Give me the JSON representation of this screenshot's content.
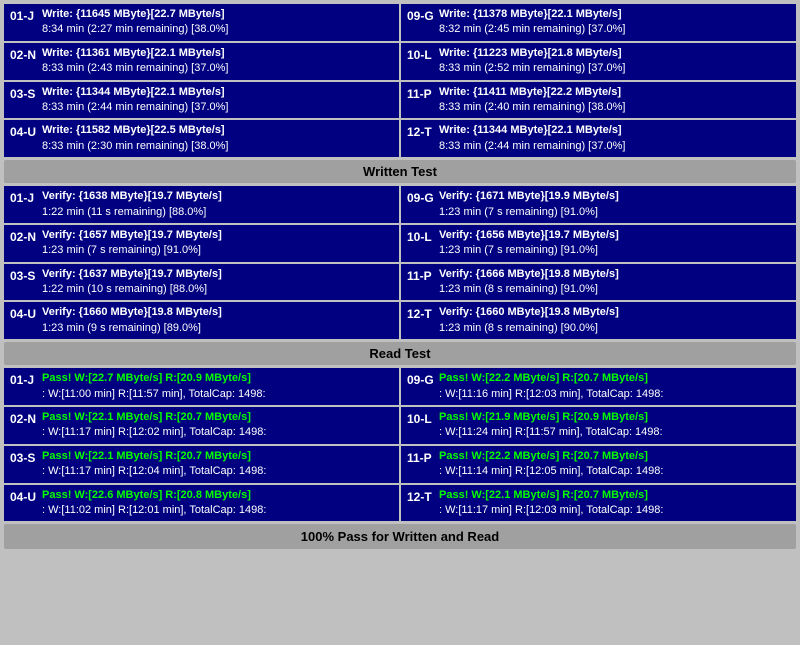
{
  "sections": {
    "write": {
      "header": "Written Test",
      "left_cells": [
        {
          "label": "01-J",
          "line1": "Write: {11645 MByte}[22.7 MByte/s]",
          "line2": "8:34 min (2:27 min remaining)  [38.0%]"
        },
        {
          "label": "02-N",
          "line1": "Write: {11361 MByte}[22.1 MByte/s]",
          "line2": "8:33 min (2:43 min remaining)  [37.0%]"
        },
        {
          "label": "03-S",
          "line1": "Write: {11344 MByte}[22.1 MByte/s]",
          "line2": "8:33 min (2:44 min remaining)  [37.0%]"
        },
        {
          "label": "04-U",
          "line1": "Write: {11582 MByte}[22.5 MByte/s]",
          "line2": "8:33 min (2:30 min remaining)  [38.0%]"
        }
      ],
      "right_cells": [
        {
          "label": "09-G",
          "line1": "Write: {11378 MByte}[22.1 MByte/s]",
          "line2": "8:32 min (2:45 min remaining)  [37.0%]"
        },
        {
          "label": "10-L",
          "line1": "Write: {11223 MByte}[21.8 MByte/s]",
          "line2": "8:33 min (2:52 min remaining)  [37.0%]"
        },
        {
          "label": "11-P",
          "line1": "Write: {11411 MByte}[22.2 MByte/s]",
          "line2": "8:33 min (2:40 min remaining)  [38.0%]"
        },
        {
          "label": "12-T",
          "line1": "Write: {11344 MByte}[22.1 MByte/s]",
          "line2": "8:33 min (2:44 min remaining)  [37.0%]"
        }
      ]
    },
    "verify": {
      "header": "Written Test",
      "left_cells": [
        {
          "label": "01-J",
          "line1": "Verify: {1638 MByte}[19.7 MByte/s]",
          "line2": "1:22 min (11 s remaining)  [88.0%]"
        },
        {
          "label": "02-N",
          "line1": "Verify: {1657 MByte}[19.7 MByte/s]",
          "line2": "1:23 min (7 s remaining)  [91.0%]"
        },
        {
          "label": "03-S",
          "line1": "Verify: {1637 MByte}[19.7 MByte/s]",
          "line2": "1:22 min (10 s remaining)  [88.0%]"
        },
        {
          "label": "04-U",
          "line1": "Verify: {1660 MByte}[19.8 MByte/s]",
          "line2": "1:23 min (9 s remaining)  [89.0%]"
        }
      ],
      "right_cells": [
        {
          "label": "09-G",
          "line1": "Verify: {1671 MByte}[19.9 MByte/s]",
          "line2": "1:23 min (7 s remaining)  [91.0%]"
        },
        {
          "label": "10-L",
          "line1": "Verify: {1656 MByte}[19.7 MByte/s]",
          "line2": "1:23 min (7 s remaining)  [91.0%]"
        },
        {
          "label": "11-P",
          "line1": "Verify: {1666 MByte}[19.8 MByte/s]",
          "line2": "1:23 min (8 s remaining)  [91.0%]"
        },
        {
          "label": "12-T",
          "line1": "Verify: {1660 MByte}[19.8 MByte/s]",
          "line2": "1:23 min (8 s remaining)  [90.0%]"
        }
      ]
    },
    "read": {
      "header": "Read Test",
      "left_cells": [
        {
          "label": "01-J",
          "line1": "Pass! W:[22.7 MByte/s] R:[20.9 MByte/s]",
          "line2": ": W:[11:00 min] R:[11:57 min], TotalCap: 1498:"
        },
        {
          "label": "02-N",
          "line1": "Pass! W:[22.1 MByte/s] R:[20.7 MByte/s]",
          "line2": ": W:[11:17 min] R:[12:02 min], TotalCap: 1498:"
        },
        {
          "label": "03-S",
          "line1": "Pass! W:[22.1 MByte/s] R:[20.7 MByte/s]",
          "line2": ": W:[11:17 min] R:[12:04 min], TotalCap: 1498:"
        },
        {
          "label": "04-U",
          "line1": "Pass! W:[22.6 MByte/s] R:[20.8 MByte/s]",
          "line2": ": W:[11:02 min] R:[12:01 min], TotalCap: 1498:"
        }
      ],
      "right_cells": [
        {
          "label": "09-G",
          "line1": "Pass! W:[22.2 MByte/s] R:[20.7 MByte/s]",
          "line2": ": W:[11:16 min] R:[12:03 min], TotalCap: 1498:"
        },
        {
          "label": "10-L",
          "line1": "Pass! W:[21.9 MByte/s] R:[20.9 MByte/s]",
          "line2": ": W:[11:24 min] R:[11:57 min], TotalCap: 1498:"
        },
        {
          "label": "11-P",
          "line1": "Pass! W:[22.2 MByte/s] R:[20.7 MByte/s]",
          "line2": ": W:[11:14 min] R:[12:05 min], TotalCap: 1498:"
        },
        {
          "label": "12-T",
          "line1": "Pass! W:[22.1 MByte/s] R:[20.7 MByte/s]",
          "line2": ": W:[11:17 min] R:[12:03 min], TotalCap: 1498:"
        }
      ]
    }
  },
  "footer": "100% Pass for Written and Read",
  "headers": {
    "write_section": "Written Test",
    "read_section": "Read Test"
  }
}
